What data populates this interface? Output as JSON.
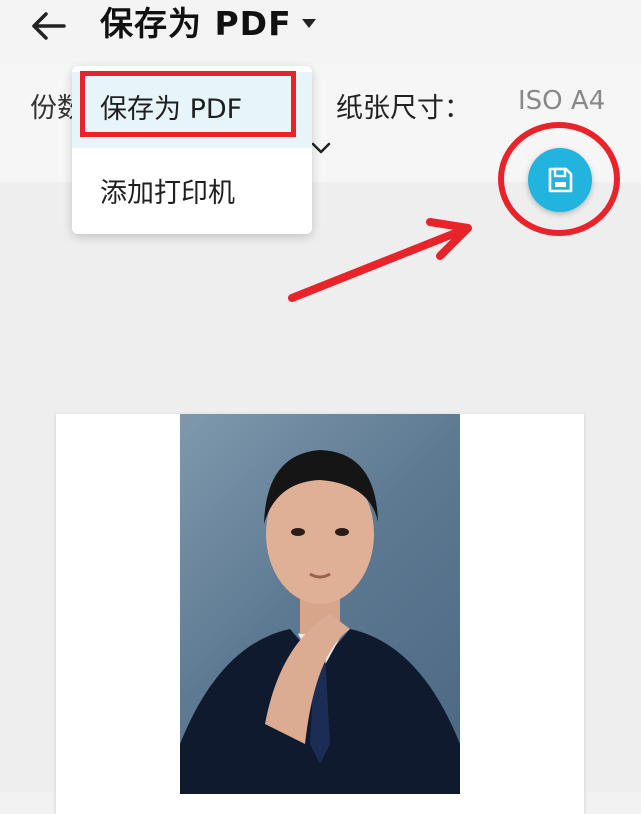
{
  "header": {
    "title": "保存为 PDF",
    "back_icon": "arrow-left-icon",
    "dropdown_icon": "caret-down-icon"
  },
  "options": {
    "copies_label": "份数",
    "paper_size_label": "纸张尺寸：",
    "paper_size_value": "ISO A4",
    "expand_icon": "chevron-down-icon"
  },
  "printer_menu": {
    "items": [
      {
        "label": "保存为 PDF",
        "selected": true
      },
      {
        "label": "添加打印机",
        "selected": false
      }
    ]
  },
  "fab": {
    "icon": "save-icon",
    "color": "#21b4de"
  },
  "annotations": {
    "color": "#e8242a"
  }
}
